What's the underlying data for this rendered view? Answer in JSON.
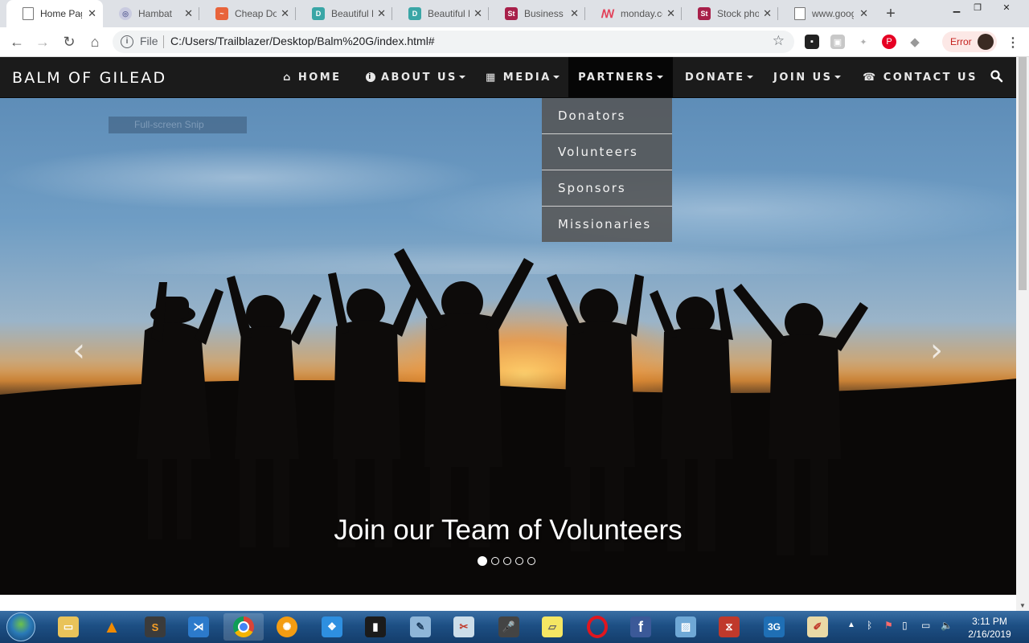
{
  "browser": {
    "tabs": [
      {
        "label": "Home Page",
        "icon": "page-icon",
        "color": "#5f6368",
        "active": true
      },
      {
        "label": "Hambat",
        "icon": "globe-icon",
        "color": "#8a8fb8"
      },
      {
        "label": "Cheap Do",
        "icon": "chart-icon",
        "color": "#e8643b"
      },
      {
        "label": "Beautiful D",
        "icon": "d-icon",
        "color": "#3aa6a6"
      },
      {
        "label": "Beautiful D",
        "icon": "d-icon",
        "color": "#3aa6a6"
      },
      {
        "label": "Business P",
        "icon": "st-icon",
        "color": "#a8204a"
      },
      {
        "label": "monday.co",
        "icon": "monday-icon",
        "color": "#e2445c"
      },
      {
        "label": "Stock pho",
        "icon": "st-icon",
        "color": "#a8204a"
      },
      {
        "label": "www.goog",
        "icon": "page-icon",
        "color": "#5f6368"
      }
    ],
    "address": {
      "scheme_label": "File",
      "url": "C:/Users/Trailblazer/Desktop/Balm%20G/index.html#"
    },
    "profile_status": "Error"
  },
  "site": {
    "brand": "BALM OF GILEAD",
    "nav": [
      {
        "label": "HOME",
        "icon": "home-icon",
        "dropdown": false
      },
      {
        "label": "ABOUT US",
        "icon": "info-icon",
        "dropdown": true
      },
      {
        "label": "MEDIA",
        "icon": "film-icon",
        "dropdown": true
      },
      {
        "label": "PARTNERS",
        "icon": "",
        "dropdown": true,
        "open": true
      },
      {
        "label": "DONATE",
        "icon": "",
        "dropdown": true
      },
      {
        "label": "JOIN US",
        "icon": "",
        "dropdown": true
      },
      {
        "label": "CONTACT US",
        "icon": "phone-icon",
        "dropdown": false
      }
    ],
    "partners_menu": [
      "Donators",
      "Volunteers",
      "Sponsors",
      "Missionaries"
    ],
    "hero": {
      "caption": "Join our Team of Volunteers",
      "slides_total": 5,
      "active_slide": 1
    },
    "snip_overlay": "Full-screen Snip"
  },
  "taskbar": {
    "clock_time": "3:11 PM",
    "clock_date": "2/16/2019"
  }
}
